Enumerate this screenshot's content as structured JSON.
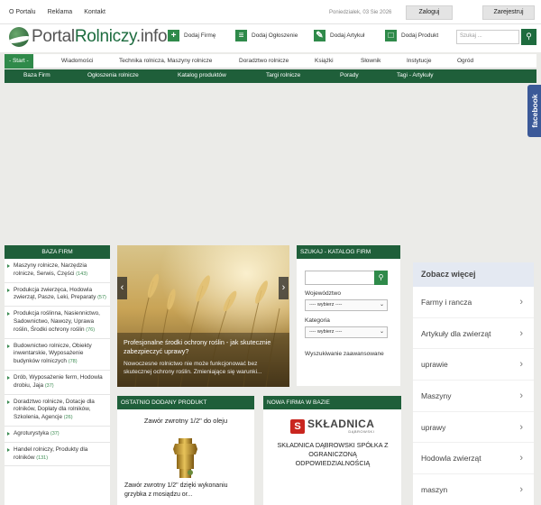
{
  "topbar": {
    "links": [
      "O Portalu",
      "Reklama",
      "Kontakt"
    ],
    "date": "Poniedziałek, 03 Sie 2026",
    "login": "Zaloguj",
    "register": "Zarejestruj"
  },
  "header": {
    "logo_a": "Portal",
    "logo_b": "Rolniczy",
    "logo_c": ".info",
    "buttons": [
      "Dodaj Firmę",
      "Dodaj Ogłoszenie",
      "Dodaj Artykuł",
      "Dodaj Produkt"
    ],
    "search_placeholder": "Szukaj ..."
  },
  "nav1": [
    "- Start -",
    "Wiadomości",
    "Technika rolnicza, Maszyny rolnicze",
    "Doradztwo rolnicze",
    "Książki",
    "Słownik",
    "Instytucje",
    "Ogród"
  ],
  "nav2": [
    "Baza Firm",
    "Ogłoszenia rolnicze",
    "Katalog produktów",
    "Targi rolnicze",
    "Porady",
    "Tagi - Artykuły"
  ],
  "facebook": "facebook",
  "baza": {
    "title": "BAZA FIRM",
    "items": [
      {
        "label": "Maszyny rolnicze, Narzędzia rolnicze, Serwis, Części",
        "count": "(143)"
      },
      {
        "label": "Produkcja zwierzęca, Hodowla zwierząt, Pasze, Leki, Preparaty",
        "count": "(57)"
      },
      {
        "label": "Produkcja roślinna, Nasiennictwo, Sadownictwo, Nawozy, Uprawa roślin, Środki ochrony roślin",
        "count": "(76)"
      },
      {
        "label": "Budownictwo rolnicze, Obiekty inwentarskie, Wyposażenie budynków rolniczych",
        "count": "(78)"
      },
      {
        "label": "Drób, Wyposażenie ferm, Hodowla drobiu, Jaja",
        "count": "(37)"
      },
      {
        "label": "Doradztwo rolnicze, Dotacje dla rolników, Dopłaty dla rolników, Szkolenia, Agencje",
        "count": "(26)"
      },
      {
        "label": "Agroturystyka",
        "count": "(37)"
      },
      {
        "label": "Handel rolniczy, Produkty dla rolników",
        "count": "(131)"
      }
    ]
  },
  "slider": {
    "title": "Profesjonalne środki ochrony roślin - jak skutecznie zabezpieczyć uprawy?",
    "text": "Nowoczesne rolnictwo nie może funkcjonować bez skutecznej ochrony roślin. Zmieniające się warunki...",
    "prev": "‹",
    "next": "›"
  },
  "szukaj": {
    "title": "SZUKAJ - KATALOG FIRM",
    "wojewodztwo_label": "Województwo",
    "wojewodztwo_value": "---- wybierz ----",
    "kategoria_label": "Kategoria",
    "kategoria_value": "---- wybierz ----",
    "advanced": "Wyszukiwanie zaawansowane"
  },
  "zobacz": {
    "title": "Zobacz więcej",
    "items": [
      "Farmy i rancza",
      "Artykuły dla zwierząt",
      "uprawie",
      "Maszyny",
      "uprawy",
      "Hodowla zwierząt",
      "maszyn"
    ]
  },
  "produkt": {
    "title": "OSTATNIO DODANY PRODUKT",
    "name": "Zawór zwrotny 1/2\" do oleju",
    "desc": "Zawór zwrotny 1/2\" dzięki wykonaniu grzybka z mosiądzu or..."
  },
  "firma": {
    "title": "NOWA FIRMA W BAZIE",
    "logo_letter": "S",
    "logo_name": "SKŁADNICA",
    "logo_sub": "DĄBROWSKI",
    "desc": "SKŁADNICA DĄBROWSKI SPÓŁKA Z OGRANICZONĄ ODPOWIEDZIALNOŚCIĄ"
  },
  "colors": {
    "brand_green": "#1f5f3a",
    "accent_green": "#2f8a4a",
    "facebook_blue": "#3b5998"
  }
}
